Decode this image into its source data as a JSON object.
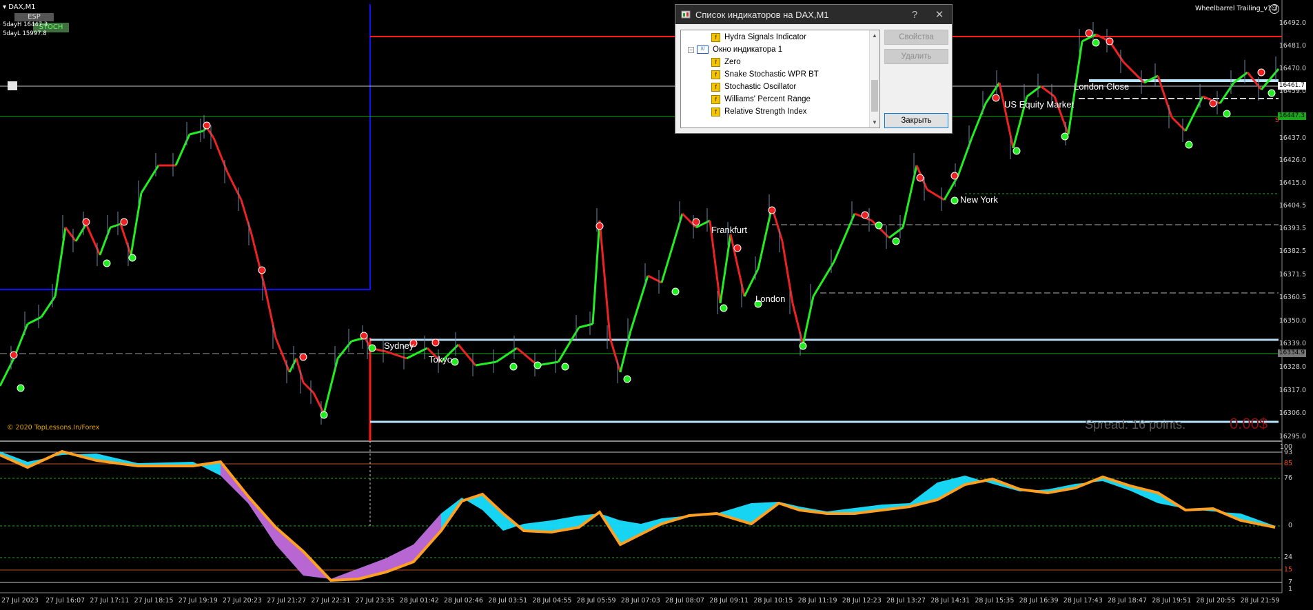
{
  "chart": {
    "symbol_title": "DAX,M1",
    "five_day_high": "5dayH 16447.3",
    "five_day_low": "5dayL 15997.8",
    "btn_esp": "ESP",
    "btn_stoch": "STOCH",
    "ea_name": "Wheelbarrel Trailing_v1.2",
    "copyright": "© 2020 TopLessons.In/Forex",
    "spread_text": "Spread: 16 points.",
    "profit_text": "0.00$",
    "current_price": "16461.7",
    "green_level_price": "16447.3",
    "low_level_price": "16334.9",
    "right_marker": "S"
  },
  "sessions": {
    "sydney": "Sydney",
    "tokyo": "Tokyo",
    "frankfurt": "Frankfurt",
    "london": "London",
    "new_york": "New York",
    "us_equity": "US Equity Market",
    "london_close": "London Close"
  },
  "price_axis": [
    "16492.0",
    "16481.0",
    "16470.0",
    "16459.0",
    "16437.0",
    "16426.0",
    "16415.0",
    "16404.5",
    "16393.5",
    "16382.5",
    "16371.5",
    "16360.5",
    "16350.0",
    "16339.0",
    "16328.0",
    "16317.0",
    "16306.0",
    "16295.0"
  ],
  "indicator_axis": [
    "100",
    "93",
    "85",
    "76",
    "0",
    "24",
    "15",
    "7",
    "1"
  ],
  "time_axis": [
    "27 Jul 2023",
    "27 Jul 16:07",
    "27 Jul 17:11",
    "27 Jul 18:15",
    "27 Jul 19:19",
    "27 Jul 20:23",
    "27 Jul 21:27",
    "27 Jul 22:31",
    "27 Jul 23:35",
    "28 Jul 01:42",
    "28 Jul 02:46",
    "28 Jul 03:51",
    "28 Jul 04:55",
    "28 Jul 05:59",
    "28 Jul 07:03",
    "28 Jul 08:07",
    "28 Jul 09:11",
    "28 Jul 10:15",
    "28 Jul 11:19",
    "28 Jul 12:23",
    "28 Jul 13:27",
    "28 Jul 14:31",
    "28 Jul 15:35",
    "28 Jul 16:39",
    "28 Jul 17:43",
    "28 Jul 18:47",
    "28 Jul 19:51",
    "28 Jul 20:55",
    "28 Jul 21:59"
  ],
  "dialog": {
    "title": "Список индикаторов на DAX,M1",
    "help": "?",
    "close": "✕",
    "tree": [
      {
        "label": "Hydra Signals Indicator",
        "kind": "ind",
        "level": 2
      },
      {
        "label": "Окно индикатора 1",
        "kind": "win",
        "level": 1
      },
      {
        "label": "Zero",
        "kind": "ind",
        "level": 2
      },
      {
        "label": "Snake Stochastic WPR BT",
        "kind": "ind",
        "level": 2
      },
      {
        "label": "Stochastic Oscillator",
        "kind": "ind",
        "level": 2
      },
      {
        "label": "Williams' Percent Range",
        "kind": "ind",
        "level": 2
      },
      {
        "label": "Relative Strength Index",
        "kind": "ind",
        "level": 2
      }
    ],
    "btn_properties": "Свойства",
    "btn_delete": "Удалить",
    "btn_close": "Закрыть"
  },
  "colors": {
    "bull": "#22ee22",
    "bear": "#ee2222",
    "indicator_orange": "#ffa020",
    "indicator_cyan": "#18e0ff",
    "indicator_violet": "#c060d0"
  }
}
